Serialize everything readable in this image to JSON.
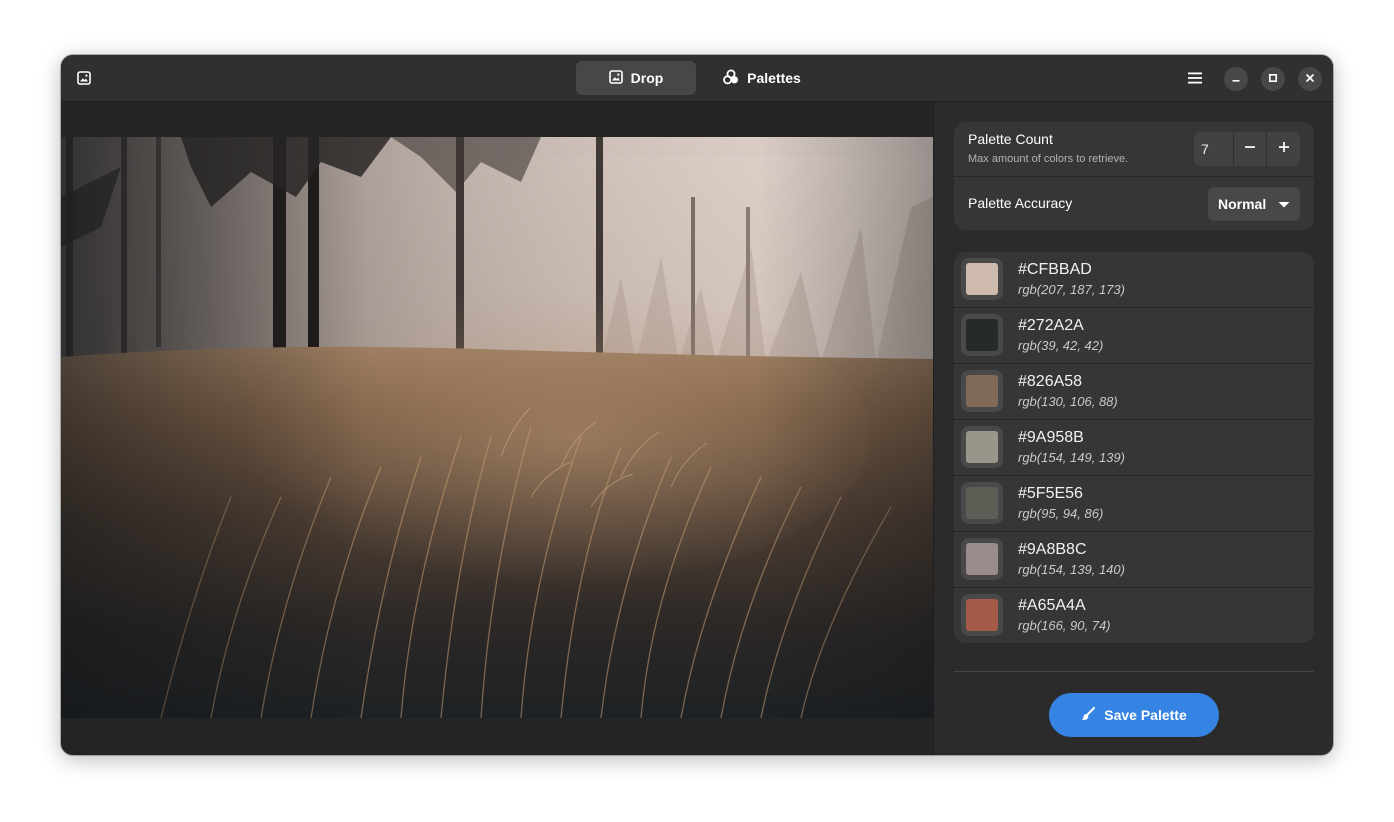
{
  "header": {
    "tabs": [
      {
        "label": "Drop",
        "icon": "image-icon",
        "active": true
      },
      {
        "label": "Palettes",
        "icon": "palettes-icon",
        "active": false
      }
    ],
    "icons": {
      "app": "image-icon",
      "menu": "hamburger-menu-icon",
      "minimize": "minimize-icon",
      "maximize": "maximize-icon",
      "close": "close-icon"
    }
  },
  "preferences": {
    "count": {
      "title": "Palette Count",
      "subtitle": "Max amount of colors to retrieve.",
      "value": "7"
    },
    "accuracy": {
      "title": "Palette Accuracy",
      "value": "Normal"
    }
  },
  "palette": [
    {
      "hex": "#CFBBAD",
      "rgb": "rgb(207, 187, 173)",
      "color": "#CFBBAD"
    },
    {
      "hex": "#272A2A",
      "rgb": "rgb(39, 42, 42)",
      "color": "#272A2A"
    },
    {
      "hex": "#826A58",
      "rgb": "rgb(130, 106, 88)",
      "color": "#826A58"
    },
    {
      "hex": "#9A958B",
      "rgb": "rgb(154, 149, 139)",
      "color": "#9A958B"
    },
    {
      "hex": "#5F5E56",
      "rgb": "rgb(95, 94, 86)",
      "color": "#5F5E56"
    },
    {
      "hex": "#9A8B8C",
      "rgb": "rgb(154, 139, 140)",
      "color": "#9A8B8C"
    },
    {
      "hex": "#A65A4A",
      "rgb": "rgb(166, 90, 74)",
      "color": "#A65A4A"
    }
  ],
  "actions": {
    "save_label": "Save Palette"
  },
  "theme": {
    "accent": "#3584e4",
    "window_bg": "#242424",
    "card_bg": "#363636"
  }
}
